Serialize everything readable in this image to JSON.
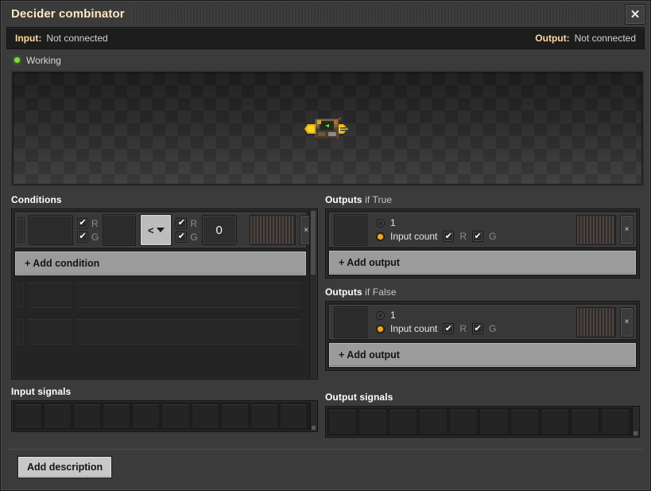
{
  "window": {
    "title": "Decider combinator",
    "close_label": "✕"
  },
  "connection": {
    "input_label": "Input:",
    "input_value": "Not connected",
    "output_label": "Output:",
    "output_value": "Not connected"
  },
  "status": {
    "text": "Working",
    "dot_color": "#7fdc38"
  },
  "preview": {
    "entity_name": "decider-combinator-sprite"
  },
  "conditions": {
    "label": "Conditions",
    "add_label": "+ Add condition",
    "rows": [
      {
        "left_signal": "",
        "left_red_checked": true,
        "left_red_label": "R",
        "left_green_checked": true,
        "left_green_label": "G",
        "comparator": "<",
        "right_red_checked": true,
        "right_red_label": "R",
        "right_green_checked": true,
        "right_green_label": "G",
        "constant": "0",
        "delete_label": "×"
      }
    ],
    "ghost_row_count": 3
  },
  "outputs_if_true": {
    "label_bold": "Outputs",
    "label_sub": "if True",
    "add_label": "+ Add output",
    "rows": [
      {
        "signal": "",
        "one_label": "1",
        "one_selected": false,
        "input_count_label": "Input count",
        "input_count_selected": true,
        "red_checked": true,
        "red_label": "R",
        "green_checked": true,
        "green_label": "G",
        "delete_label": "×"
      }
    ]
  },
  "outputs_if_false": {
    "label_bold": "Outputs",
    "label_sub": "if False",
    "add_label": "+ Add output",
    "rows": [
      {
        "signal": "",
        "one_label": "1",
        "one_selected": false,
        "input_count_label": "Input count",
        "input_count_selected": true,
        "red_checked": true,
        "red_label": "R",
        "green_checked": true,
        "green_label": "G",
        "delete_label": "×"
      }
    ]
  },
  "input_signals": {
    "label": "Input signals",
    "slot_count": 10,
    "values": []
  },
  "output_signals": {
    "label": "Output signals",
    "slot_count": 10,
    "values": []
  },
  "footer": {
    "add_description_label": "Add description"
  },
  "colors": {
    "accent_gold": "#ffe6c0",
    "status_green": "#7fdc38",
    "radio_on": "#f0a81e",
    "button_light": "#9b9b9b",
    "panel_dark": "#242424"
  }
}
